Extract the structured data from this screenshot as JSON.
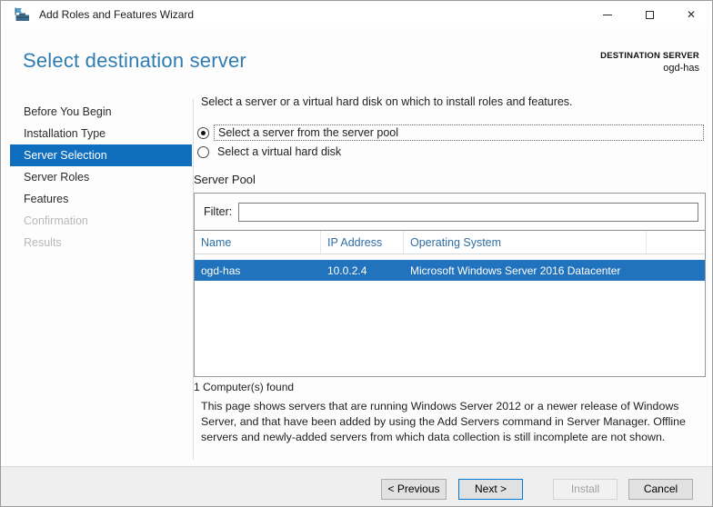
{
  "window": {
    "title": "Add Roles and Features Wizard",
    "icons": {
      "app": "server-manager-toolbox-icon",
      "minimize": "minimize-icon",
      "maximize": "maximize-icon",
      "close": "✕"
    }
  },
  "header": {
    "title": "Select destination server",
    "destination_label": "DESTINATION SERVER",
    "destination_server": "ogd-has"
  },
  "sidebar": {
    "items": [
      {
        "label": "Before You Begin",
        "state": "normal"
      },
      {
        "label": "Installation Type",
        "state": "normal"
      },
      {
        "label": "Server Selection",
        "state": "selected"
      },
      {
        "label": "Server Roles",
        "state": "normal"
      },
      {
        "label": "Features",
        "state": "normal"
      },
      {
        "label": "Confirmation",
        "state": "disabled"
      },
      {
        "label": "Results",
        "state": "disabled"
      }
    ]
  },
  "main": {
    "intro": "Select a server or a virtual hard disk on which to install roles and features.",
    "radios": [
      {
        "label": "Select a server from the server pool",
        "selected": true
      },
      {
        "label": "Select a virtual hard disk",
        "selected": false
      }
    ],
    "server_pool": {
      "heading": "Server Pool",
      "filter_label": "Filter:",
      "filter_value": "",
      "columns": [
        "Name",
        "IP Address",
        "Operating System"
      ],
      "rows": [
        {
          "name": "ogd-has",
          "ip": "10.0.2.4",
          "os": "Microsoft Windows Server 2016 Datacenter",
          "selected": true
        }
      ],
      "found_text": "1 Computer(s) found"
    },
    "description": "This page shows servers that are running Windows Server 2012 or a newer release of Windows Server, and that have been added by using the Add Servers command in Server Manager. Offline servers and newly-added servers from which data collection is still incomplete are not shown."
  },
  "footer": {
    "buttons": [
      {
        "label": "< Previous",
        "state": "enabled"
      },
      {
        "label": "Next >",
        "state": "default"
      },
      {
        "label": "Install",
        "state": "disabled"
      },
      {
        "label": "Cancel",
        "state": "enabled"
      }
    ]
  },
  "colors": {
    "sidebar_selected_bg": "#106ebe",
    "row_selected_bg": "#2173bd",
    "page_title": "#2e7cb0",
    "column_header_text": "#2e6da4",
    "default_button_border": "#0078d7"
  }
}
